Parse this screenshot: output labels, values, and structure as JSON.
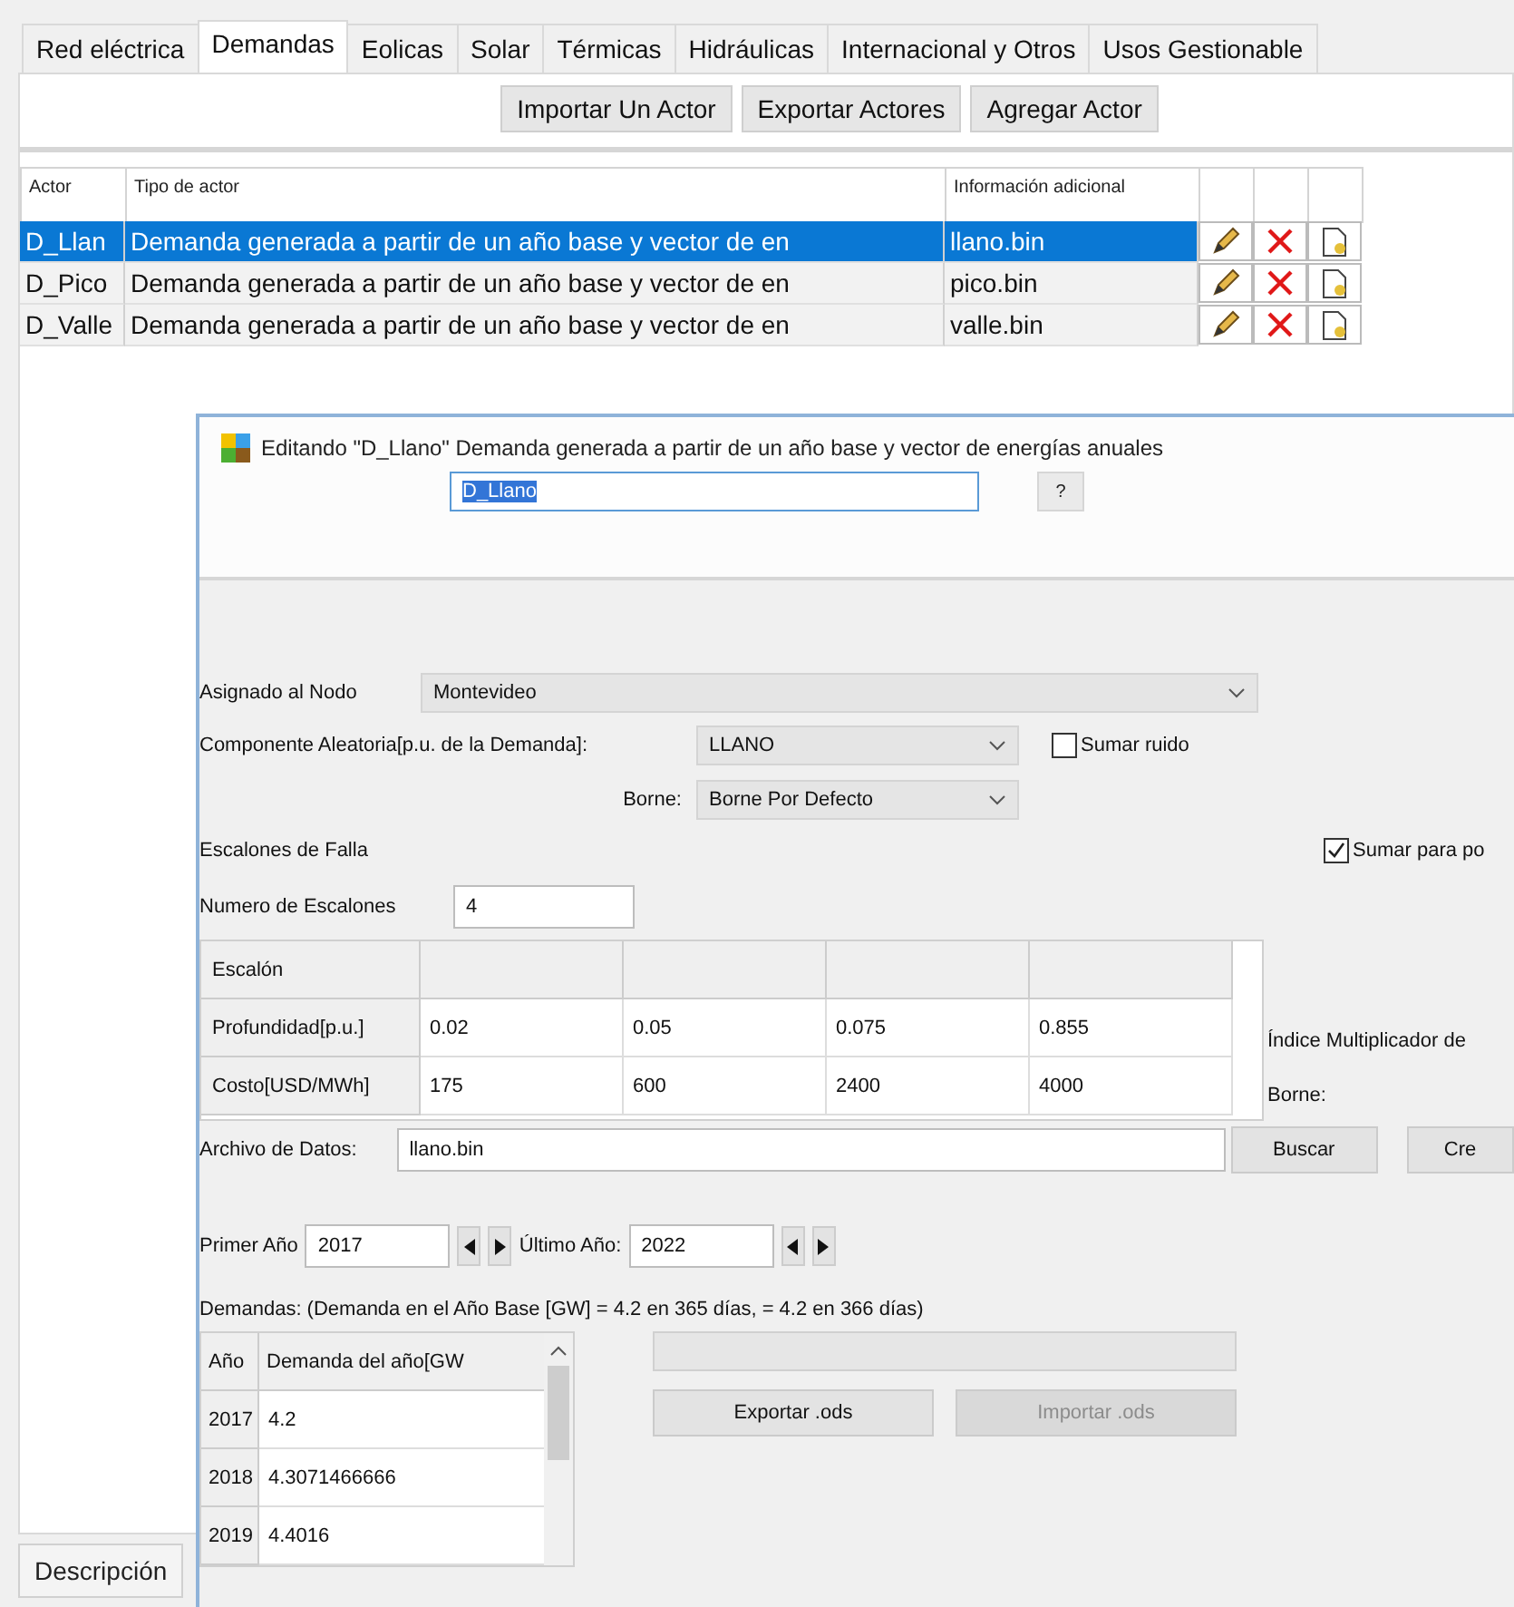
{
  "tabs": [
    {
      "label": "Red eléctrica",
      "selected": false
    },
    {
      "label": "Demandas",
      "selected": true
    },
    {
      "label": "Eolicas",
      "selected": false
    },
    {
      "label": "Solar",
      "selected": false
    },
    {
      "label": "Térmicas",
      "selected": false
    },
    {
      "label": "Hidráulicas",
      "selected": false
    },
    {
      "label": "Internacional y Otros",
      "selected": false
    },
    {
      "label": "Usos Gestionable",
      "selected": false
    }
  ],
  "toolbar": [
    "Importar Un Actor",
    "Exportar Actores",
    "Agregar Actor"
  ],
  "actors_table": {
    "columns": [
      "Actor",
      "Tipo de actor",
      "Información adicional"
    ],
    "rows": [
      {
        "actor": "D_Llan",
        "type": "Demanda generada a partir de un año base y vector de en",
        "info": "llano.bin",
        "selected": true
      },
      {
        "actor": "D_Pico",
        "type": "Demanda generada a partir de un año base y vector de en",
        "info": "pico.bin",
        "selected": false
      },
      {
        "actor": "D_Valle",
        "type": "Demanda generada a partir de un año base y vector de en",
        "info": "valle.bin",
        "selected": false
      }
    ]
  },
  "bottom_tab": "Descripción",
  "dialog": {
    "title": "Editando \"D_Llano\" Demanda generada a partir de un año base y vector de energías anuales",
    "name": "D_Llano",
    "help": "?",
    "node": {
      "label": "Asignado al Nodo",
      "value": "Montevideo"
    },
    "component": {
      "label": "Componente Aleatoria[p.u. de la Demanda]:",
      "value": "LLANO"
    },
    "sumar_ruido": {
      "label": "Sumar ruido",
      "checked": false
    },
    "borne": {
      "label": "Borne:",
      "value": "Borne Por Defecto"
    },
    "escalones_title": "Escalones de Falla",
    "sumar_para": {
      "label": "Sumar para po",
      "checked": true
    },
    "num_escalones": {
      "label": "Numero de Escalones",
      "value": "4"
    },
    "fault_table": {
      "corner": "Escalón",
      "rows": [
        {
          "header": "Profundidad[p.u.]",
          "cells": [
            "0.02",
            "0.05",
            "0.075",
            "0.855"
          ]
        },
        {
          "header": "Costo[USD/MWh]",
          "cells": [
            "175",
            "600",
            "2400",
            "4000"
          ]
        }
      ]
    },
    "side_labels": [
      "Índice Multiplicador de",
      "Borne:"
    ],
    "file": {
      "label": "Archivo de Datos:",
      "value": "llano.bin"
    },
    "file_buttons": [
      "Buscar",
      "Cre"
    ],
    "first_year": {
      "label": "Primer Año",
      "value": "2017"
    },
    "last_year": {
      "label": "Último Año:",
      "value": "2022"
    },
    "demand_note": "Demandas: (Demanda en el Año Base [GW] = 4.2 en 365 días, = 4.2 en 366 días)",
    "year_table": {
      "columns": [
        "Año",
        "Demanda del año[GW"
      ],
      "rows": [
        [
          "2017",
          "4.2"
        ],
        [
          "2018",
          "4.3071466666"
        ],
        [
          "2019",
          "4.4016"
        ]
      ]
    },
    "progress": {
      "level": 0
    },
    "ods_buttons": [
      {
        "label": "Exportar .ods",
        "disabled": false
      },
      {
        "label": "Importar .ods",
        "disabled": true
      }
    ]
  }
}
